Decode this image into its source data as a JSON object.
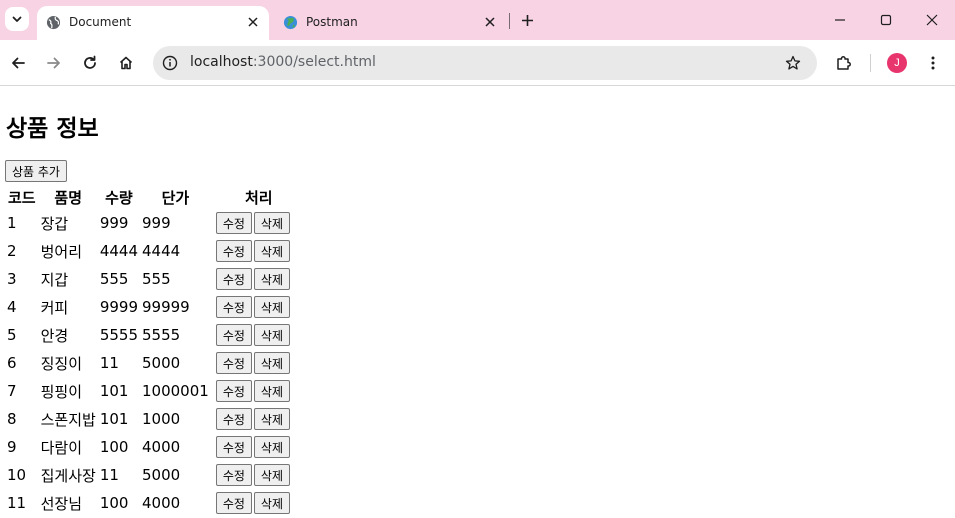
{
  "browser": {
    "tabs": [
      {
        "title": "Document",
        "active": true
      },
      {
        "title": "Postman",
        "active": false
      }
    ],
    "url": {
      "host": "localhost",
      "path": ":3000/select.html"
    },
    "profile_initial": "J",
    "colors": {
      "frame": "#f7d3e4",
      "avatar": "#e8356e"
    }
  },
  "page": {
    "heading": "상품 정보",
    "add_button": "상품 추가",
    "columns": [
      "코드",
      "품명",
      "수량",
      "단가",
      "처리"
    ],
    "edit_label": "수정",
    "delete_label": "삭제",
    "rows": [
      {
        "code": "1",
        "name": "장갑",
        "qty": "999",
        "price": "999"
      },
      {
        "code": "2",
        "name": "벙어리",
        "qty": "4444",
        "price": "4444"
      },
      {
        "code": "3",
        "name": "지갑",
        "qty": "555",
        "price": "555"
      },
      {
        "code": "4",
        "name": "커피",
        "qty": "9999",
        "price": "99999"
      },
      {
        "code": "5",
        "name": "안경",
        "qty": "5555",
        "price": "5555"
      },
      {
        "code": "6",
        "name": "징징이",
        "qty": "11",
        "price": "5000"
      },
      {
        "code": "7",
        "name": "핑핑이",
        "qty": "101",
        "price": "1000001"
      },
      {
        "code": "8",
        "name": "스폰지밥",
        "qty": "101",
        "price": "1000"
      },
      {
        "code": "9",
        "name": "다람이",
        "qty": "100",
        "price": "4000"
      },
      {
        "code": "10",
        "name": "집게사장",
        "qty": "11",
        "price": "5000"
      },
      {
        "code": "11",
        "name": "선장님",
        "qty": "100",
        "price": "4000"
      }
    ]
  }
}
